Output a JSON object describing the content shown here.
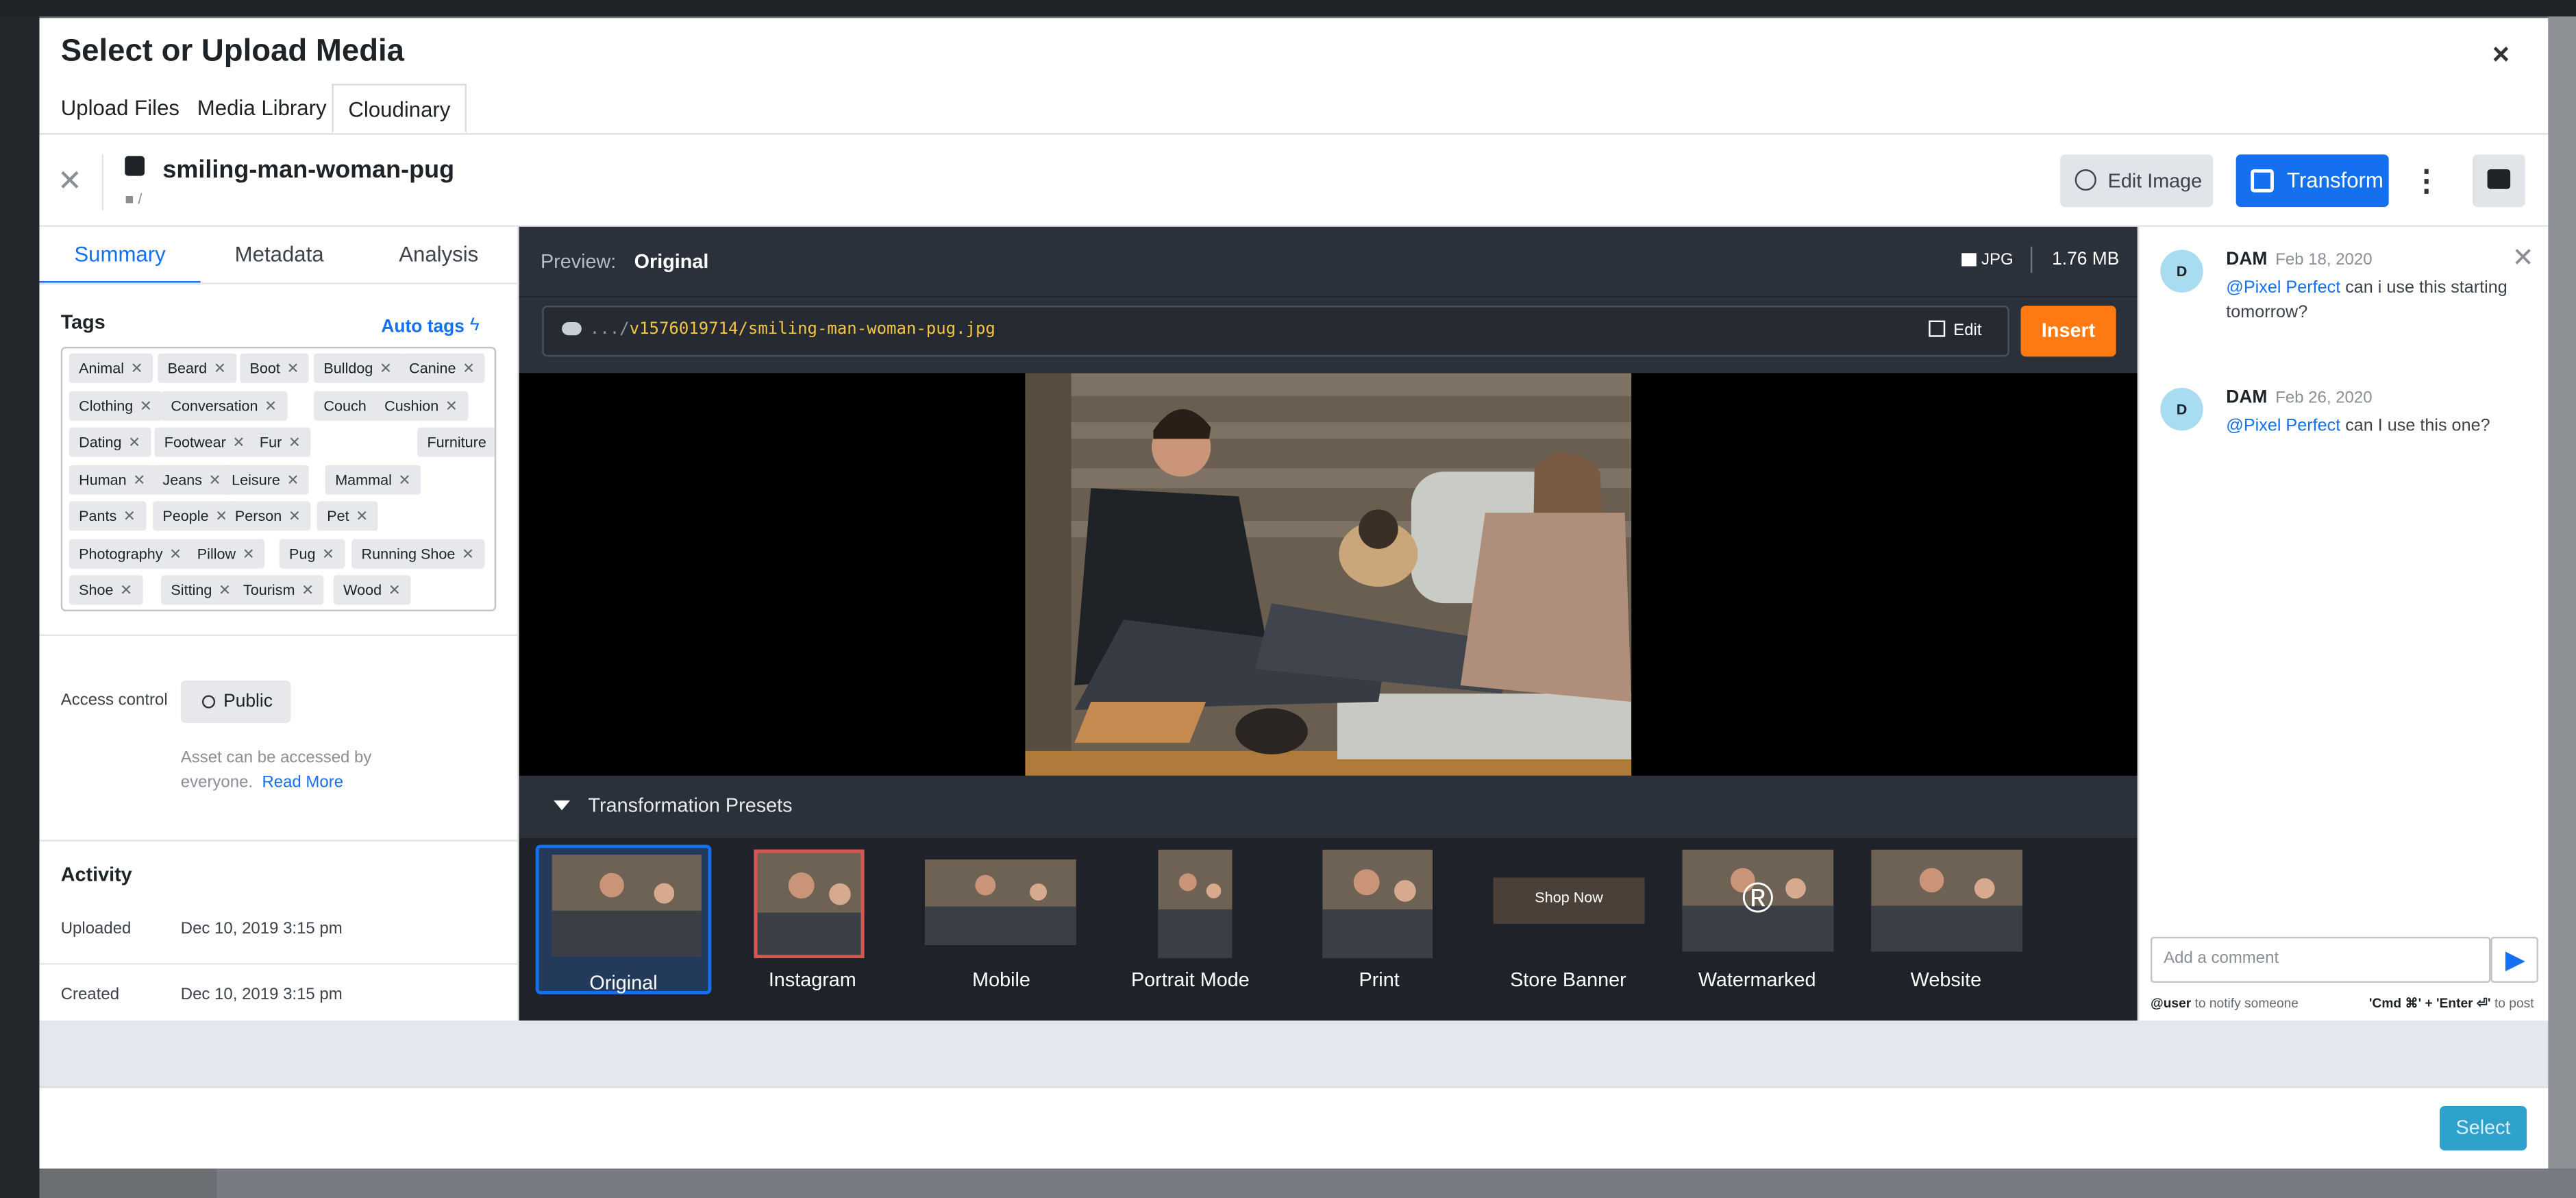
{
  "modal": {
    "title": "Select or Upload Media",
    "close": "×",
    "tabs": [
      "Upload Files",
      "Media Library",
      "Cloudinary"
    ]
  },
  "asset": {
    "name": "smiling-man-woman-pug",
    "folder": "/",
    "edit_image": "Edit Image",
    "transform": "Transform"
  },
  "left_tabs": [
    "Summary",
    "Metadata",
    "Analysis"
  ],
  "tags": {
    "heading": "Tags",
    "auto_tags": "Auto tags",
    "items": [
      "Animal",
      "Beard",
      "Boot",
      "Bulldog",
      "Canine",
      "Clothing",
      "Conversation",
      "Couch",
      "Cushion",
      "Dating",
      "Footwear",
      "Fur",
      "Furniture",
      "Human",
      "Jeans",
      "Leisure",
      "Mammal",
      "Pants",
      "People",
      "Person",
      "Pet",
      "Photography",
      "Pillow",
      "Pug",
      "Running Shoe",
      "Shoe",
      "Sitting",
      "Tourism",
      "Wood"
    ]
  },
  "access": {
    "label": "Access control",
    "value": "Public",
    "note": "Asset can be accessed by everyone.",
    "read_more": "Read More"
  },
  "activity": {
    "heading": "Activity",
    "uploaded_label": "Uploaded",
    "uploaded_value": "Dec 10, 2019 3:15 pm",
    "created_label": "Created",
    "created_value": "Dec 10, 2019 3:15 pm"
  },
  "preview": {
    "label": "Preview:",
    "value": "Original",
    "format": "JPG",
    "size": "1.76 MB",
    "url_prefix": ".../",
    "url": "v1576019714/smiling-man-woman-pug.jpg",
    "edit": "Edit",
    "insert": "Insert"
  },
  "presets": {
    "title": "Transformation Presets",
    "items": [
      "Original",
      "Instagram",
      "Mobile",
      "Portrait Mode",
      "Print",
      "Store Banner",
      "Watermarked",
      "Website"
    ],
    "banner_text": "Shop Now",
    "watermark_symbol": "®"
  },
  "comments": [
    {
      "avatar": "D",
      "author": "DAM",
      "date": "Feb 18, 2020",
      "mention": "@Pixel Perfect",
      "text": " can i use this starting tomorrow?"
    },
    {
      "avatar": "D",
      "author": "DAM",
      "date": "Feb 26, 2020",
      "mention": "@Pixel Perfect",
      "text": " can I use this one?"
    }
  ],
  "comment_box": {
    "placeholder": "Add a comment",
    "hint_left_key": "@user",
    "hint_left": " to notify someone",
    "hint_right_key": "'Cmd ⌘' + 'Enter ⏎'",
    "hint_right": " to post"
  },
  "footer": {
    "select": "Select"
  },
  "colors": {
    "accent": "#1570ef",
    "insert": "#ff7a12",
    "select": "#2ea2cc",
    "dark_panel": "#2b313a"
  }
}
